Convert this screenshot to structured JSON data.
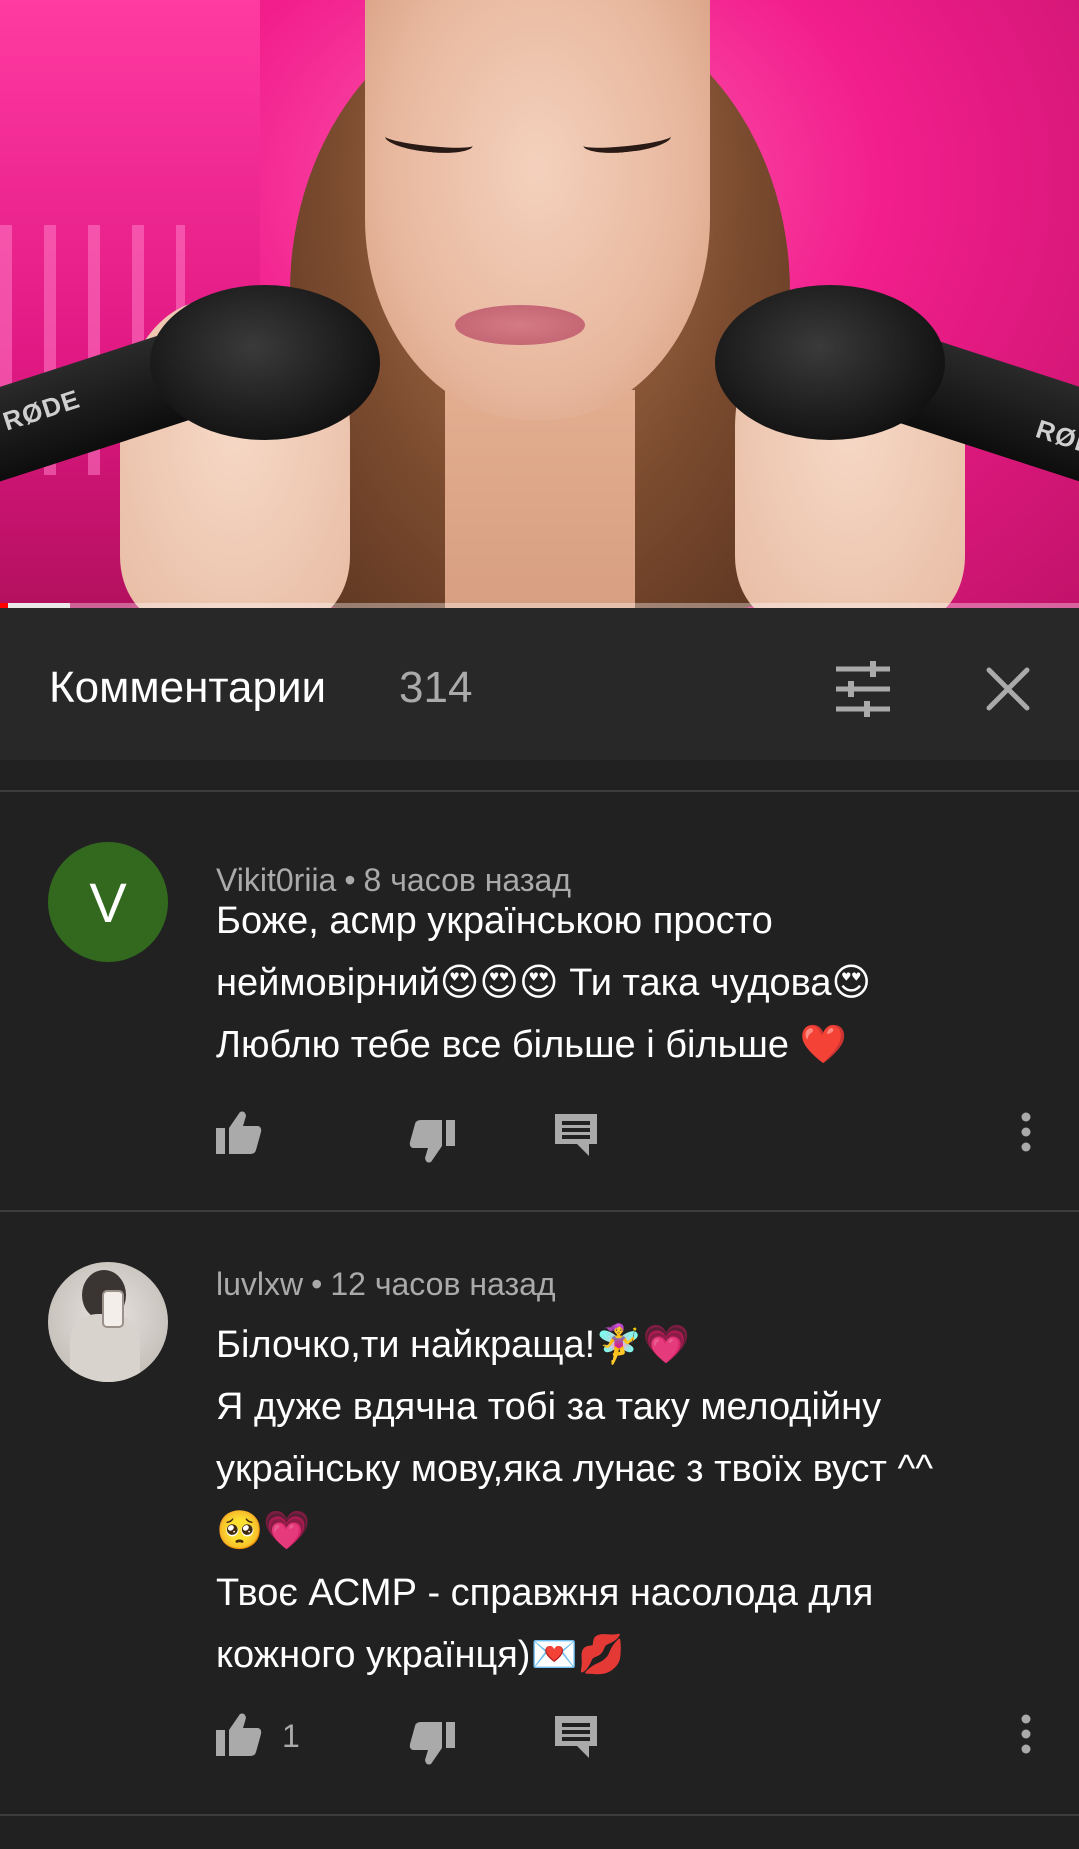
{
  "video": {
    "brand_left": "RØDE",
    "brand_right": "RØDE",
    "progress": 0.007,
    "buffered": 0.065
  },
  "comments_panel": {
    "title": "Комментарии",
    "count": "314"
  },
  "comments": [
    {
      "author": "Vikit0riia",
      "avatar_letter": "V",
      "separator": "•",
      "time": "8 часов назад",
      "lines": [
        "Боже, асмр українською просто",
        "неймовірний😍😍😍 Ти така чудова😍",
        "Люблю тебе все більше і  більше ❤️"
      ],
      "likes": ""
    },
    {
      "author": "luvlxw",
      "separator": "•",
      "time": "12 часов назад",
      "lines": [
        "Білочко,ти найкраща!🧚‍♀️💗",
        "Я дуже вдячна тобі за таку мелодійну",
        "українську мову,яка лунає з твоїх вуст ^^",
        "🥺💗",
        "Твоє АСМР - справжня насолода для",
        "кожного українця)💌💋"
      ],
      "likes": "1"
    }
  ],
  "colors": {
    "background": "#212121",
    "header": "#282828",
    "accent": "#ff0000",
    "avatar_v": "#33691e"
  },
  "icons": [
    "filter-icon",
    "close-icon",
    "thumbs-up-icon",
    "thumbs-down-icon",
    "reply-icon",
    "more-vert-icon"
  ]
}
